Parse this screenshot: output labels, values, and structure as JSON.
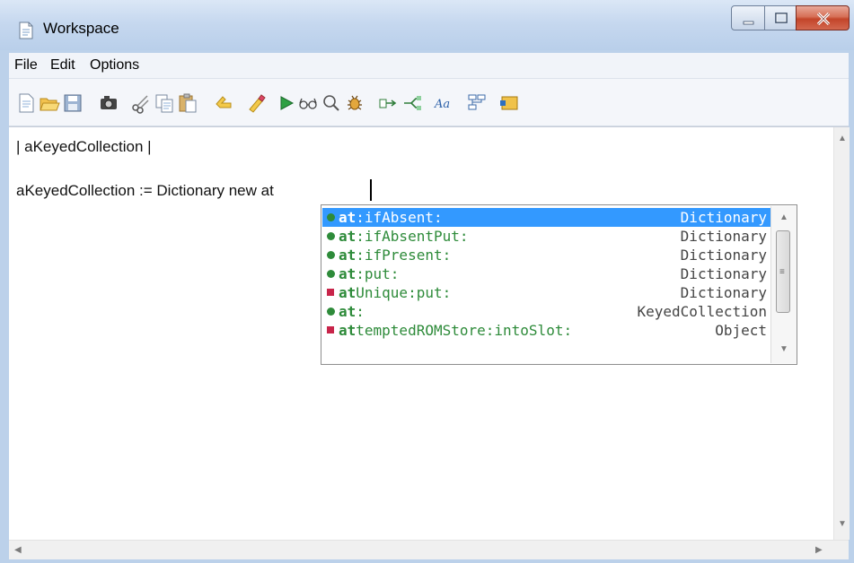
{
  "window": {
    "title": "Workspace"
  },
  "menu": [
    "File",
    "Edit",
    "Options"
  ],
  "toolbar": {
    "icons": [
      "new-file-icon",
      "open-folder-icon",
      "save-icon",
      "camera-icon",
      "cut-icon",
      "copy-icon",
      "paste-icon",
      "undo-icon",
      "redo-icon",
      "run-icon",
      "inspect-icon",
      "search-icon",
      "debug-icon",
      "step-icon",
      "step-into-icon",
      "font-icon",
      "browse-classes-icon",
      "workspace-icon"
    ],
    "font_label": "Aa"
  },
  "editor": {
    "lines": [
      "| aKeyedCollection |",
      "",
      "aKeyedCollection := Dictionary new at"
    ]
  },
  "autocomplete": {
    "prefix": "at",
    "items": [
      {
        "bold": "at",
        "rest": ":ifAbsent:",
        "class": "Dictionary",
        "icon": "green-method-icon",
        "selected": true
      },
      {
        "bold": "at",
        "rest": ":ifAbsentPut:",
        "class": "Dictionary",
        "icon": "green-method-icon",
        "selected": false
      },
      {
        "bold": "at",
        "rest": ":ifPresent:",
        "class": "Dictionary",
        "icon": "green-method-icon",
        "selected": false
      },
      {
        "bold": "at",
        "rest": ":put:",
        "class": "Dictionary",
        "icon": "green-method-icon",
        "selected": false
      },
      {
        "bold": "at",
        "rest": "Unique:put:",
        "class": "Dictionary",
        "icon": "red-method-icon",
        "selected": false
      },
      {
        "bold": "at",
        "rest": ":",
        "class": "KeyedCollection",
        "icon": "green-method-icon",
        "selected": false
      },
      {
        "bold": "at",
        "rest": "temptedROMStore:intoSlot:",
        "class": "Object",
        "icon": "red-method-icon",
        "selected": false
      }
    ]
  },
  "colors": {
    "selection": "#3399ff",
    "method_green": "#2e8b3a",
    "method_red": "#c8254a"
  }
}
